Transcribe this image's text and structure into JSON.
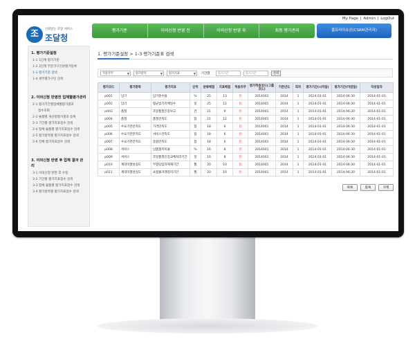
{
  "topbar": {
    "mypage": "My Page",
    "sep1": "|",
    "admin": "Admin",
    "sep2": "|",
    "logout": "LogOut"
  },
  "logo": {
    "mark": "조",
    "sub": "신뢰받는 조달 서비스",
    "name": "조달청"
  },
  "nav": {
    "items": [
      "평가기준",
      "이의신청 반영 전",
      "이의신청 반영 후",
      "최종 평가관리"
    ],
    "special": "클프라이소상(CSRM관리자)"
  },
  "sidebar": {
    "sections": [
      {
        "title": "1. 평가기준설정",
        "items": [
          "1-1 1단계 평가기준",
          "1-2 2단계 부문가구인원평가등록",
          "1-3 평가기준 검색",
          "1-4 세부평가구인 검색"
        ]
      },
      {
        "title": "2. 이의신청 반영전 업체별평가관리",
        "items": [
          "2-1 평가기간별업체별평가결과",
          "접수조회",
          "2-2 물품별 개산정평가결과 등록",
          "2-3 기간별 평가지표점수 검색",
          "2-4 업체 물품별 평가지표점수 검색",
          "2-5 평가항목별 평가지표점수 검색",
          "2-6 전체 평가지표점수 검색"
        ]
      },
      {
        "title": "3. 이의신청 반영 후 업체 결과 관리",
        "items": [
          "3-1 이의신청 반영 후 수정",
          "3-2 기간별 평가지표점수 검색",
          "3-3 업체 물품별 평가지표점수 검색",
          "3-4 평가항목별 평가지표점수 검색"
        ]
      }
    ],
    "active_item": "1-3 평가기준 검색"
  },
  "breadcrumb": {
    "text": "1. 평가기준설정 > 1-3 평가기준표 검색"
  },
  "filter": {
    "select1": "적용유무",
    "select2": "평가항목",
    "select3": "평가지표",
    "period_label": "기간별",
    "from_placeholder": "평가기간",
    "to_placeholder": "평가기간",
    "search_button": "검색"
  },
  "table": {
    "headers": [
      "평가코드",
      "평가항목",
      "평가지표",
      "단위",
      "분류배점",
      "지표배점",
      "적용유무",
      "평가적용코드(그룹코드)",
      "기준년도",
      "회차",
      "평가기간(시작일)",
      "평가기간(마감일)",
      "작성일자"
    ],
    "rows": [
      [
        "p001",
        "납기",
        "납기준수율",
        "%",
        "25",
        "13",
        "유",
        "2014001",
        "2014",
        "1",
        "2014-01-01",
        "2014-06-30",
        "2014-01-01"
      ],
      [
        "p002",
        "납기",
        "평균납기지체일수",
        "일",
        "25",
        "12",
        "유",
        "2014001",
        "2014",
        "1",
        "2014-01-01",
        "2014-06-30",
        "2014-01-01"
      ],
      [
        "p003",
        "품질",
        "조달품질인증보고",
        "건",
        "21",
        "9",
        "유",
        "2014001",
        "2014",
        "1",
        "2014-01-01",
        "2014-06-30",
        "2014-01-01"
      ],
      [
        "p004",
        "품질",
        "품질만족도",
        "점",
        "21",
        "12",
        "유",
        "2014001",
        "2014",
        "1",
        "2014-01-01",
        "2014-06-30",
        "2014-01-01"
      ],
      [
        "p005",
        "수요기관만족도",
        "가격만족도",
        "점",
        "18",
        "6",
        "유",
        "2014001",
        "2014",
        "1",
        "2014-01-01",
        "2014-06-30",
        "2014-01-01"
      ],
      [
        "p006",
        "수요기관만족도",
        "서비스만족도",
        "점",
        "18",
        "6",
        "유",
        "2014001",
        "2014",
        "1",
        "2014-01-01",
        "2014-06-30",
        "2014-01-01"
      ],
      [
        "p007",
        "수요기관만족도",
        "종합만족도",
        "점",
        "18",
        "6",
        "유",
        "2014001",
        "2014",
        "1",
        "2014-01-01",
        "2014-06-30",
        "2014-01-01"
      ],
      [
        "p008",
        "서비스",
        "납품품목비율",
        "%",
        "16",
        "8",
        "유",
        "2014001",
        "2014",
        "1",
        "2014-01-01",
        "2014-06-30",
        "2014-01-01"
      ],
      [
        "p009",
        "서비스",
        "조달품질인증교체처리기간",
        "일",
        "16",
        "8",
        "유",
        "2014001",
        "2014",
        "1",
        "2014-01-01",
        "2014-06-30",
        "2014-01-01"
      ],
      [
        "p010",
        "계약이행성실도",
        "부정당업자제재기간",
        "월",
        "20",
        "10",
        "유",
        "2014001",
        "2014",
        "1",
        "2014-01-01",
        "2014-06-30",
        "2014-01-01"
      ],
      [
        "p011",
        "계약이행성실도",
        "쇼핑몰거래정지기간",
        "월",
        "20",
        "10",
        "유",
        "2014001",
        "2014",
        "1",
        "2014-01-01",
        "2014-06-30",
        "2014-01-01"
      ]
    ]
  },
  "actions": {
    "list": "목록",
    "register": "등록",
    "delete": "삭제"
  }
}
